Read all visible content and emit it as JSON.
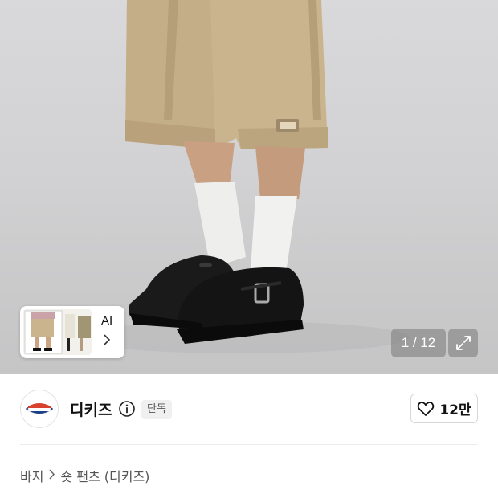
{
  "hero": {
    "thumbnail_label": "AI",
    "image_counter": "1 / 12"
  },
  "brand": {
    "name": "디키즈",
    "badge": "단독",
    "like_count": "12만"
  },
  "breadcrumb": {
    "items": [
      "바지",
      "숏 팬츠 (디키즈)"
    ]
  },
  "colors": {
    "background": "#ffffff",
    "hero_background": "#d2d2d4",
    "counter_background": "#787878",
    "badge_background": "#f0f0f0",
    "text_primary": "#111111"
  },
  "icons": [
    "expand-icon",
    "info-icon",
    "heart-icon",
    "chevron-right-icon"
  ]
}
